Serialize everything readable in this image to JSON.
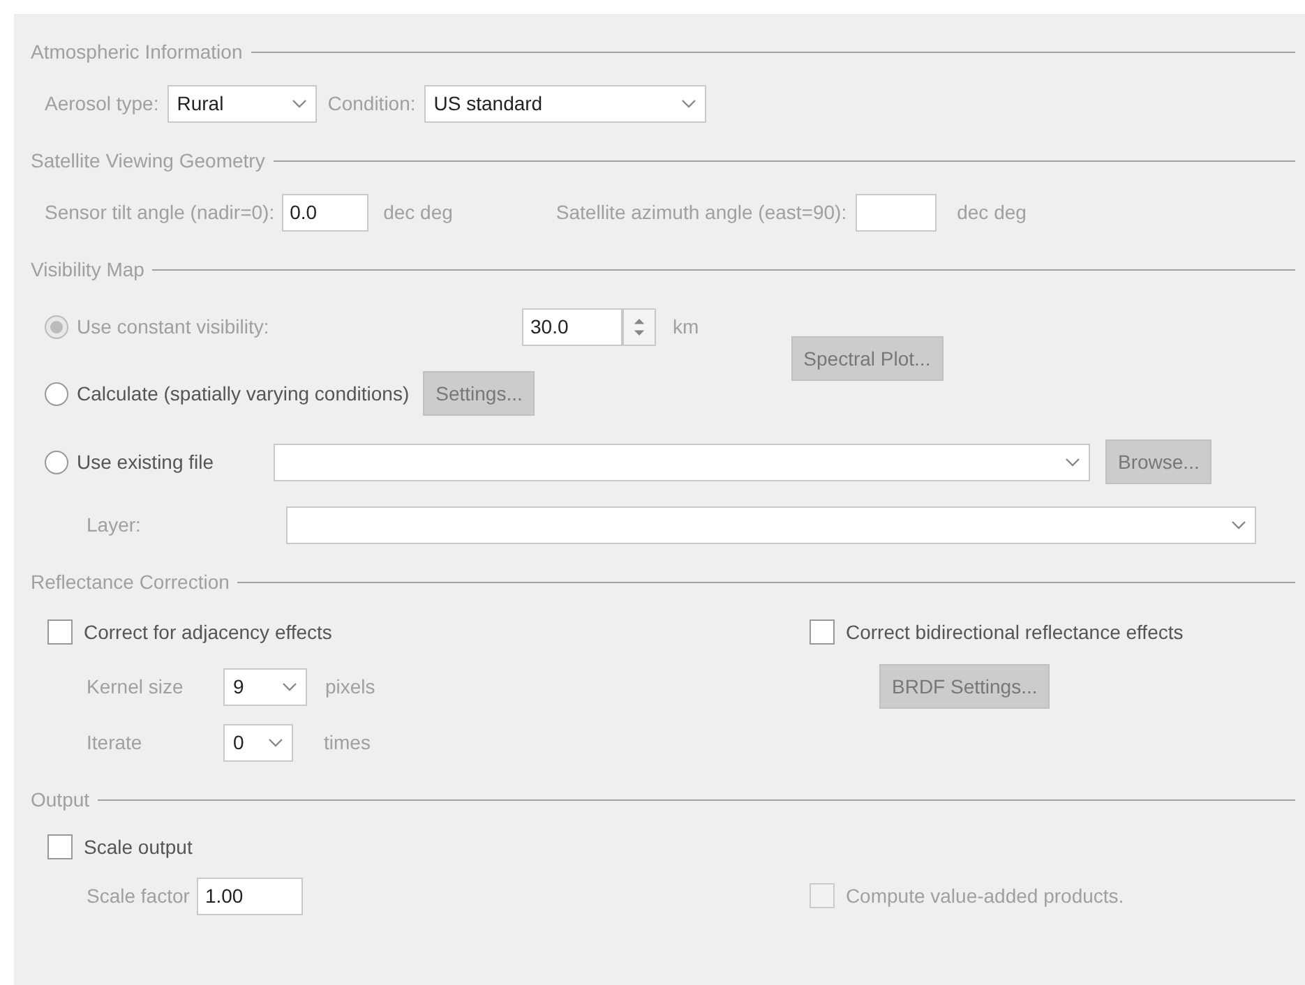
{
  "atmospheric": {
    "title": "Atmospheric Information",
    "aerosol_label": "Aerosol type:",
    "aerosol_value": "Rural",
    "condition_label": "Condition:",
    "condition_value": "US standard"
  },
  "geometry": {
    "title": "Satellite Viewing Geometry",
    "tilt_label": "Sensor tilt angle (nadir=0):",
    "tilt_value": "0.0",
    "tilt_unit": "dec deg",
    "azimuth_label": "Satellite azimuth angle (east=90):",
    "azimuth_unit": "dec deg"
  },
  "visibility": {
    "title": "Visibility Map",
    "options": [
      {
        "label": "Use constant visibility:",
        "selected": true,
        "disabled": true
      },
      {
        "label": "Calculate (spatially varying conditions)",
        "selected": false,
        "disabled": false
      },
      {
        "label": "Use existing file",
        "selected": false,
        "disabled": false
      }
    ],
    "visibility_value": "30.0",
    "visibility_unit": "km",
    "settings_button": "Settings...",
    "spectral_button": "Spectral Plot...",
    "browse_button": "Browse...",
    "layer_label": "Layer:"
  },
  "reflectance": {
    "title": "Reflectance Correction",
    "adjacency": {
      "label": "Correct for adjacency effects",
      "checked": false,
      "disabled": false
    },
    "kernel_label": "Kernel size",
    "kernel_value": "9",
    "kernel_unit": "pixels",
    "iterate_label": "Iterate",
    "iterate_value": "0",
    "iterate_unit": "times",
    "bidirectional": {
      "label": "Correct bidirectional reflectance effects",
      "checked": false,
      "disabled": false
    },
    "brdf_button": "BRDF Settings..."
  },
  "output": {
    "title": "Output",
    "scale": {
      "label": "Scale output",
      "checked": false,
      "disabled": false
    },
    "factor_label": "Scale factor",
    "factor_value": "1.00",
    "value_added": {
      "label": "Compute value-added products.",
      "checked": false,
      "disabled": true
    }
  }
}
